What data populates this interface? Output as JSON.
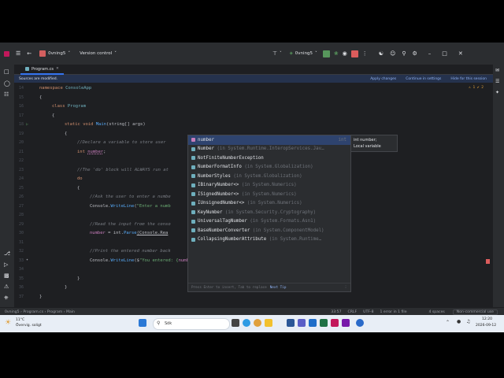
{
  "toolbar": {
    "project": "0vning5",
    "vcs": "Version control",
    "run_config": "0vning5"
  },
  "tab": {
    "label": "Program.cs"
  },
  "notice": {
    "text": "Sources are modified.",
    "apply": "Apply changes",
    "configure": "Continue in settings",
    "hide": "Hide for this session"
  },
  "editor": {
    "inspection": "⚠ 1  ✔ 2",
    "line_numbers": [
      "14",
      "15",
      "16",
      "17",
      "18",
      "19",
      "20",
      "21",
      "22",
      "23",
      "24",
      "25",
      "26",
      "27",
      "28",
      "29",
      "30",
      "31",
      "32",
      "33",
      "34",
      "35",
      "36",
      "37"
    ],
    "code": {
      "l14a": "namespace ",
      "l14b": "ConsoleApp",
      "l15": "{",
      "l16a": "class ",
      "l16b": "Program",
      "l17": "{",
      "l18a": "static ",
      "l18b": "void ",
      "l18c": "Main",
      "l18d": "(string[] args)",
      "l19": "{",
      "l20": "//Declare a variable to store user",
      "l21a": "int ",
      "l21b": "number",
      "l21c": ";",
      "l23": "//The 'do' block will ALWAYS run at",
      "l24": "do",
      "l25": "{",
      "l26": "//Ask the user to enter a numbe",
      "l27a": "Console.",
      "l27b": "WriteLine",
      "l27c": "(",
      "l27d": "\"Enter a numb",
      "l29": "//Read the input from the conso",
      "l30a": "number",
      "l30b": " = int.",
      "l30c": "Parse",
      "l30d": "(Console.Rea",
      "l32": "//Print the entered number back",
      "l33a": "Console.",
      "l33b": "WriteLine",
      "l33c": "($",
      "l33d": "\"You entered: {",
      "l33e": "number",
      "l33f": "\"",
      "l33g": ");",
      "l35": "}",
      "l36": "}",
      "l37": "}"
    }
  },
  "completion": {
    "items": [
      {
        "name": "number",
        "detail": "",
        "type": "int"
      },
      {
        "name": "Number",
        "detail": " (in System.Runtime.InteropServices.Jav…",
        "type": ""
      },
      {
        "name": "NotFiniteNumberException",
        "detail": "",
        "type": ""
      },
      {
        "name": "NumberFormatInfo",
        "detail": " (in System.Globalization)",
        "type": ""
      },
      {
        "name": "NumberStyles",
        "detail": " (in System.Globalization)",
        "type": ""
      },
      {
        "name": "IBinaryNumber<>",
        "detail": " (in System.Numerics)",
        "type": ""
      },
      {
        "name": "ISignedNumber<>",
        "detail": " (in System.Numerics)",
        "type": ""
      },
      {
        "name": "IUnsignedNumber<>",
        "detail": " (in System.Numerics)",
        "type": ""
      },
      {
        "name": "KeyNumber",
        "detail": " (in System.Security.Cryptography)",
        "type": ""
      },
      {
        "name": "UniversalTagNumber",
        "detail": " (in System.Formats.Asn1)",
        "type": ""
      },
      {
        "name": "BaseNumberConverter",
        "detail": " (in System.ComponentModel)",
        "type": ""
      },
      {
        "name": "CollapsingNumberAttribute",
        "detail": " (in System.Runtime…",
        "type": ""
      }
    ],
    "footer_hint": "Press Enter to insert, Tab to replace",
    "footer_next": "Next Tip"
  },
  "doc": {
    "line1": "int number;",
    "line2": "Local variable"
  },
  "status": {
    "breadcrumb": "0vning5 › Program.cs › Program › Main",
    "position": "33:57",
    "line_sep": "CRLF",
    "encoding": "UTF-8",
    "errors": "1 error in 1 file",
    "indent": "4 spaces",
    "license": "Non-commercial use"
  },
  "taskbar": {
    "weather_temp": "11°C",
    "weather_desc": "Övervig. soligt",
    "search": "Sök",
    "time": "12:20",
    "date": "2026-09-12"
  },
  "colors": {
    "accent": "#3574f0",
    "selection": "#2e436e",
    "ide_bg": "#1e1f22",
    "panel_bg": "#2b2d30"
  }
}
